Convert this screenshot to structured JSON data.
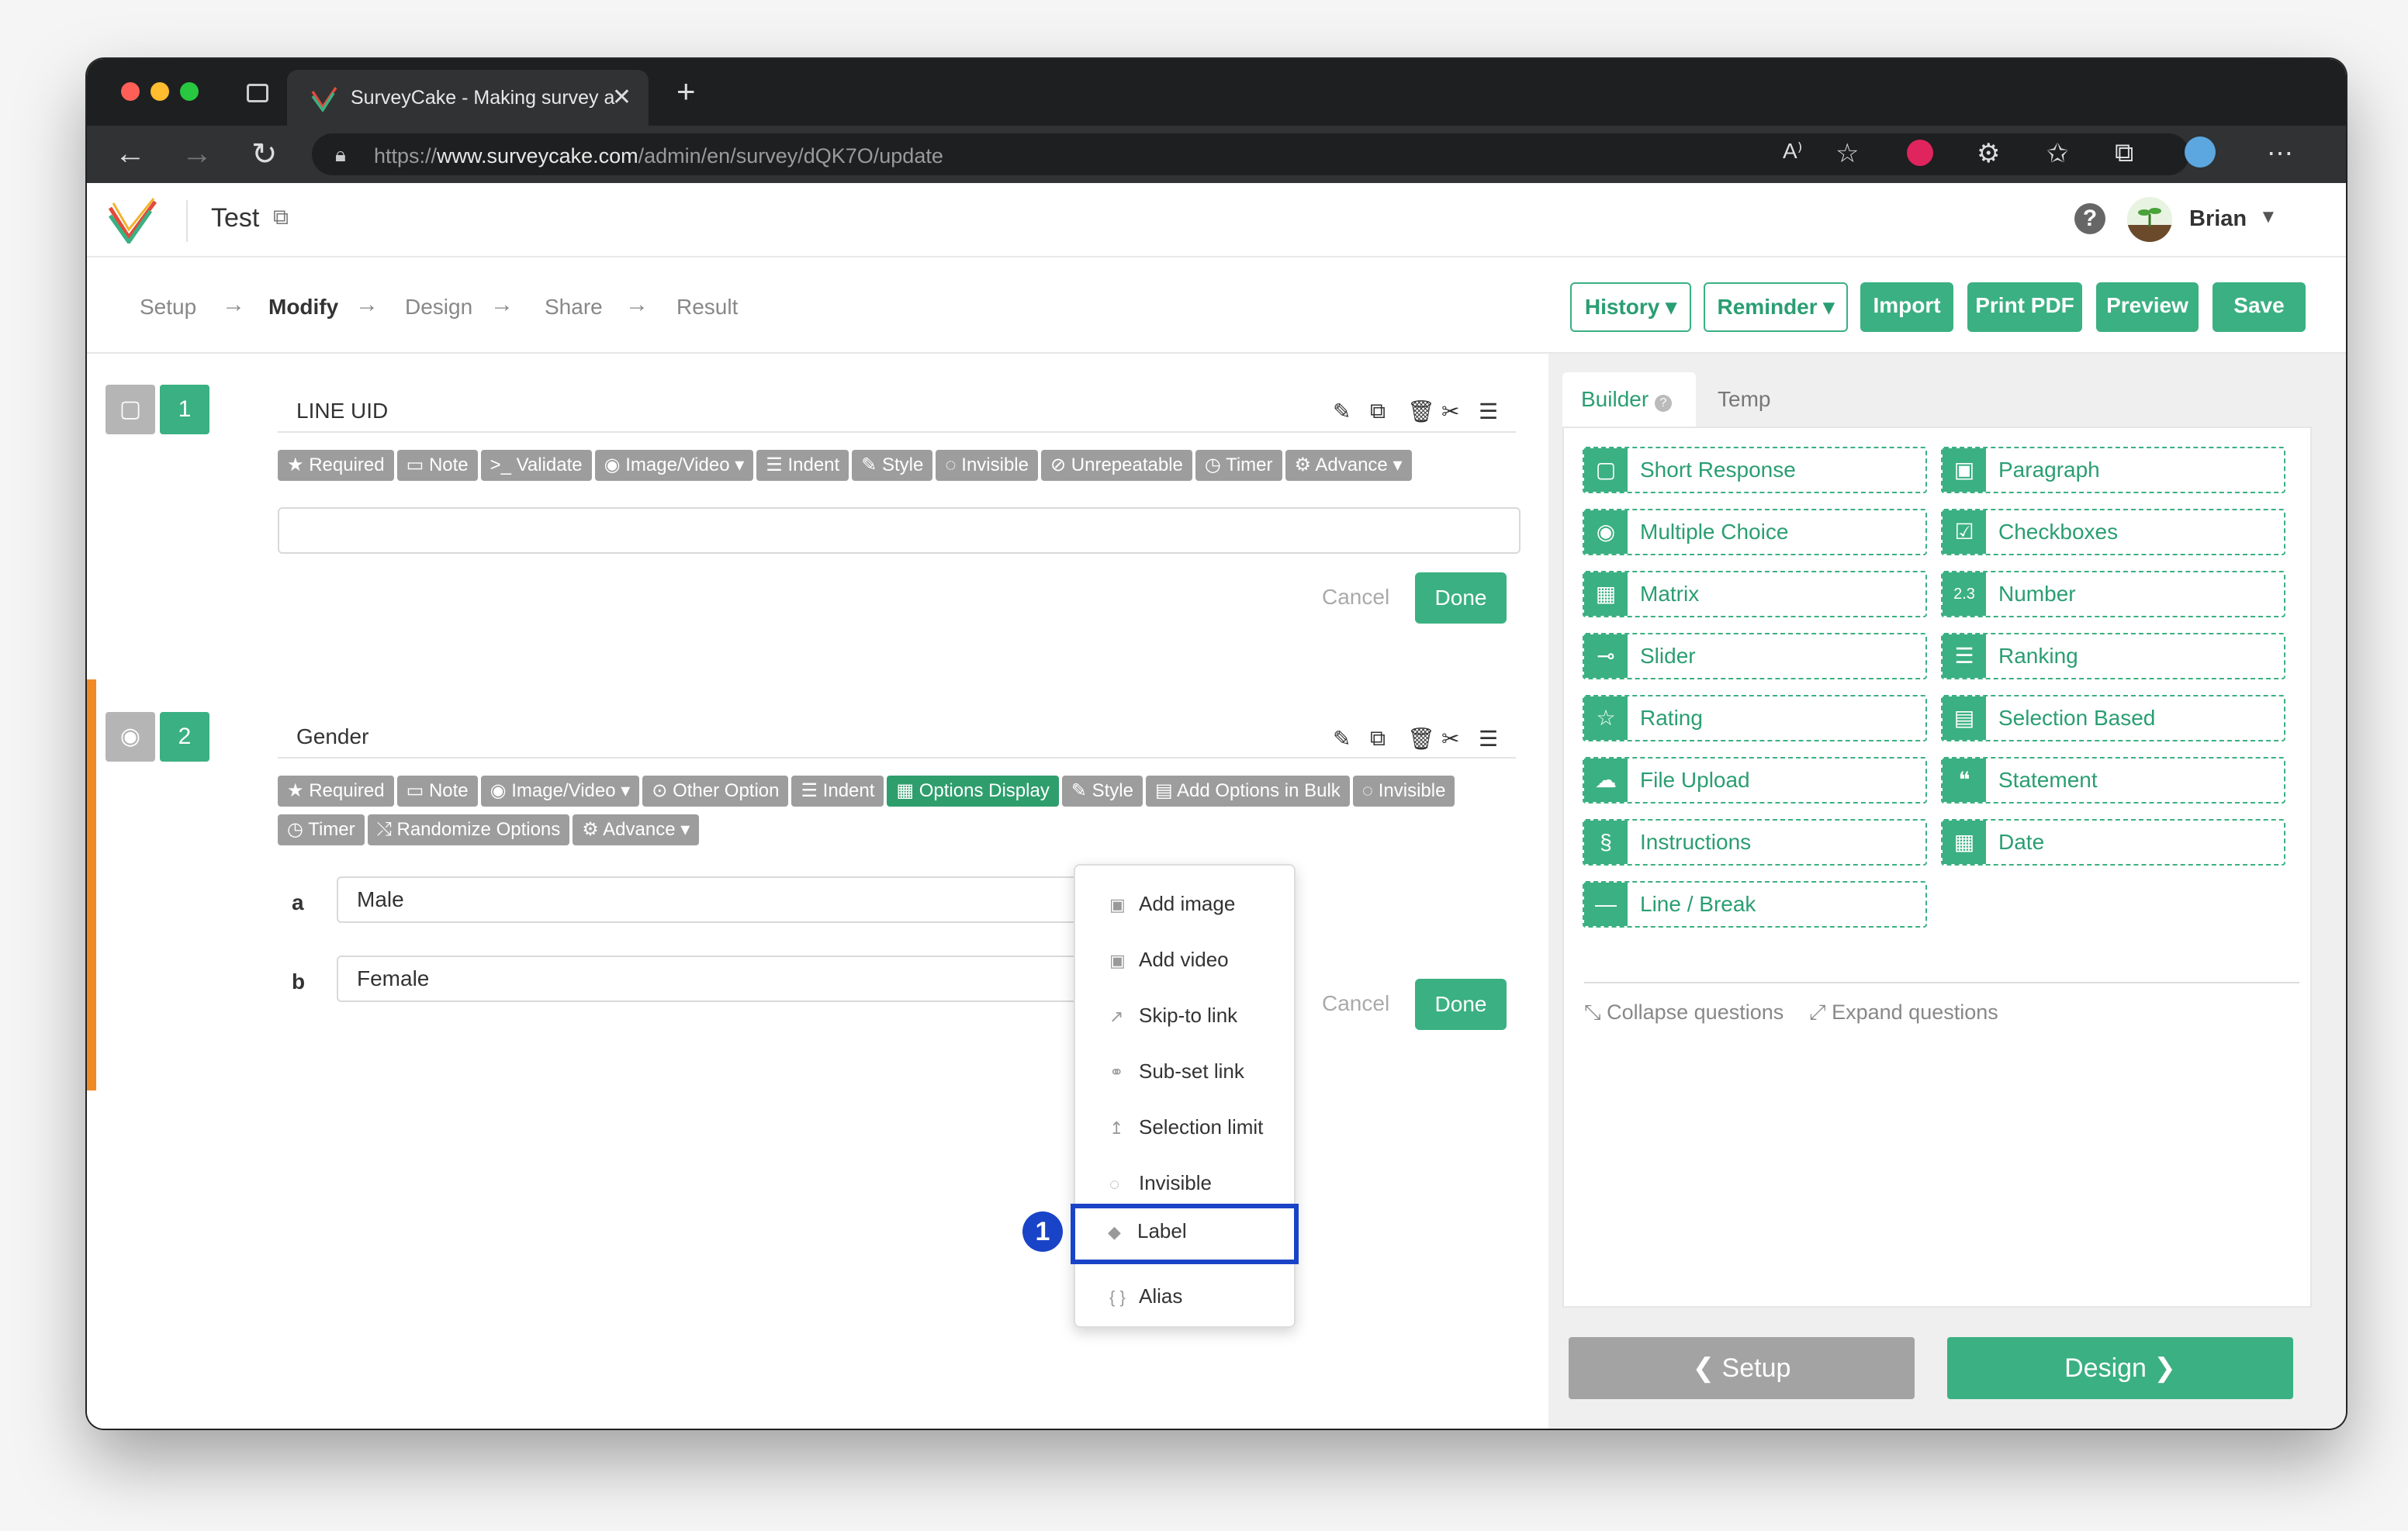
{
  "browser": {
    "tab_title": "SurveyCake - Making survey a",
    "url_prefix": "https://",
    "url_domain": "www.surveycake.com",
    "url_path": "/admin/en/survey/dQK7O/update"
  },
  "header": {
    "survey_title": "Test",
    "user_name": "Brian"
  },
  "steps": [
    "Setup",
    "Modify",
    "Design",
    "Share",
    "Result"
  ],
  "active_step": "Modify",
  "toolbar": {
    "history": "History",
    "reminder": "Reminder",
    "import": "Import",
    "print_pdf": "Print PDF",
    "preview": "Preview",
    "save": "Save"
  },
  "questions": [
    {
      "number": "1",
      "title": "LINE UID",
      "chips": [
        "Required",
        "Note",
        "Validate",
        "Image/Video",
        "Indent",
        "Style",
        "Invisible",
        "Unrepeatable",
        "Timer",
        "Advance"
      ],
      "input_value": "",
      "cancel": "Cancel",
      "done": "Done"
    },
    {
      "number": "2",
      "title": "Gender",
      "chips_row1": [
        "Required",
        "Note",
        "Image/Video",
        "Other Option",
        "Indent",
        "Options Display",
        "Style",
        "Add Options in Bulk",
        "Invisible"
      ],
      "chips_row2": [
        "Timer",
        "Randomize Options",
        "Advance"
      ],
      "options": [
        {
          "key": "a",
          "value": "Male"
        },
        {
          "key": "b",
          "value": "Female"
        }
      ],
      "cancel": "Cancel",
      "done": "Done"
    }
  ],
  "option_menu": [
    "Add image",
    "Add video",
    "Skip-to link",
    "Sub-set link",
    "Selection limit",
    "Invisible",
    "Label",
    "Alias"
  ],
  "callout_number": "1",
  "builder": {
    "tab_builder": "Builder",
    "tab_temp": "Temp",
    "items": [
      "Short Response",
      "Paragraph",
      "Multiple Choice",
      "Checkboxes",
      "Matrix",
      "Number",
      "Slider",
      "Ranking",
      "Rating",
      "Selection Based",
      "File Upload",
      "Statement",
      "Instructions",
      "Date",
      "Line / Break"
    ],
    "collapse": "Collapse questions",
    "expand": "Expand questions"
  },
  "footer": {
    "setup": "Setup",
    "design": "Design"
  },
  "colors": {
    "accent": "#3bb082",
    "accent_dark": "#2a9e72",
    "highlight": "#1a44c7",
    "active_bar": "#f08a24"
  }
}
